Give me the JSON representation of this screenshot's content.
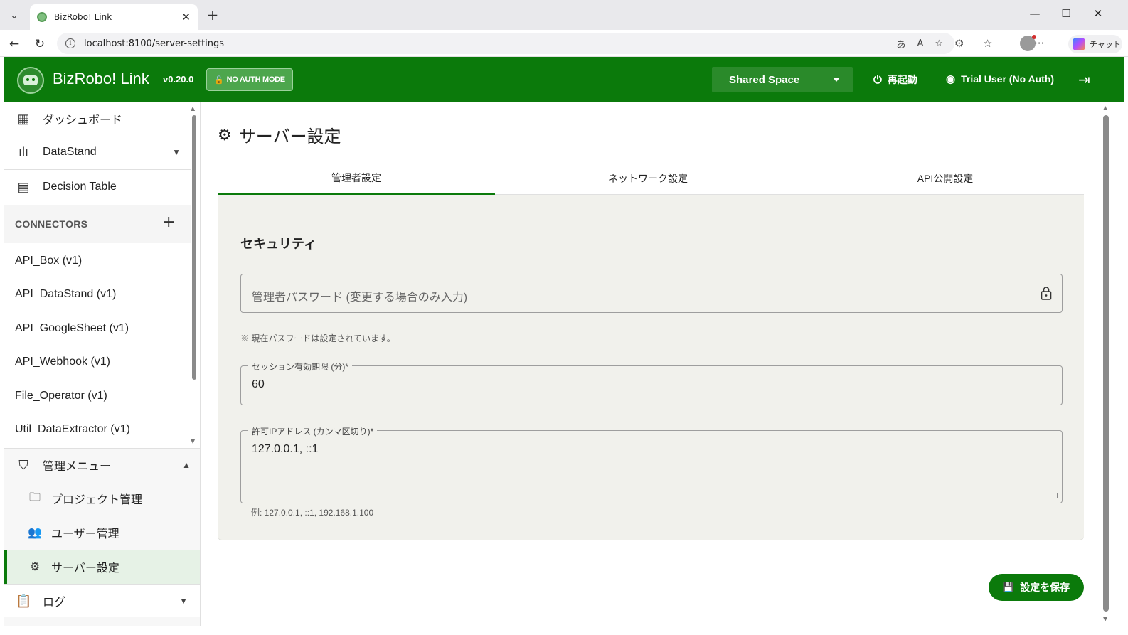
{
  "browser": {
    "tab_title": "BizRobo! Link",
    "url": "localhost:8100/server-settings",
    "copilot_label": "チャット"
  },
  "header": {
    "app_title": "BizRobo! Link",
    "version": "v0.20.0",
    "auth_badge": "NO AUTH MODE",
    "space": "Shared Space",
    "restart_label": "再起動",
    "user_label": "Trial User (No Auth)"
  },
  "sidebar": {
    "items": [
      {
        "label": "ダッシュボード",
        "icon": "dashboard-icon"
      },
      {
        "label": "DataStand",
        "icon": "bar-chart-icon"
      },
      {
        "label": "Decision Table",
        "icon": "table-icon"
      }
    ],
    "connectors_header": "CONNECTORS",
    "connectors": [
      "API_Box (v1)",
      "API_DataStand (v1)",
      "API_GoogleSheet (v1)",
      "API_Webhook (v1)",
      "File_Operator (v1)",
      "Util_DataExtractor (v1)"
    ],
    "admin_menu": "管理メニュー",
    "admin_items": [
      {
        "label": "プロジェクト管理",
        "icon": "folder-user-icon"
      },
      {
        "label": "ユーザー管理",
        "icon": "users-icon"
      },
      {
        "label": "サーバー設定",
        "icon": "gear-icon",
        "active": true
      }
    ],
    "log_label": "ログ"
  },
  "main": {
    "title": "サーバー設定",
    "tabs": [
      {
        "label": "管理者設定",
        "active": true
      },
      {
        "label": "ネットワーク設定"
      },
      {
        "label": "API公開設定"
      }
    ],
    "section_title": "セキュリティ",
    "password_placeholder": "管理者パスワード (変更する場合のみ入力)",
    "password_note": "※ 現在パスワードは設定されています。",
    "session_label": "セッション有効期限 (分)*",
    "session_value": "60",
    "ip_label": "許可IPアドレス (カンマ区切り)*",
    "ip_value": "127.0.0.1, ::1",
    "ip_hint": "例: 127.0.0.1, ::1, 192.168.1.100",
    "save_label": "設定を保存"
  },
  "colors": {
    "brand": "#0b7a0b",
    "panel": "#f1f1ec"
  }
}
